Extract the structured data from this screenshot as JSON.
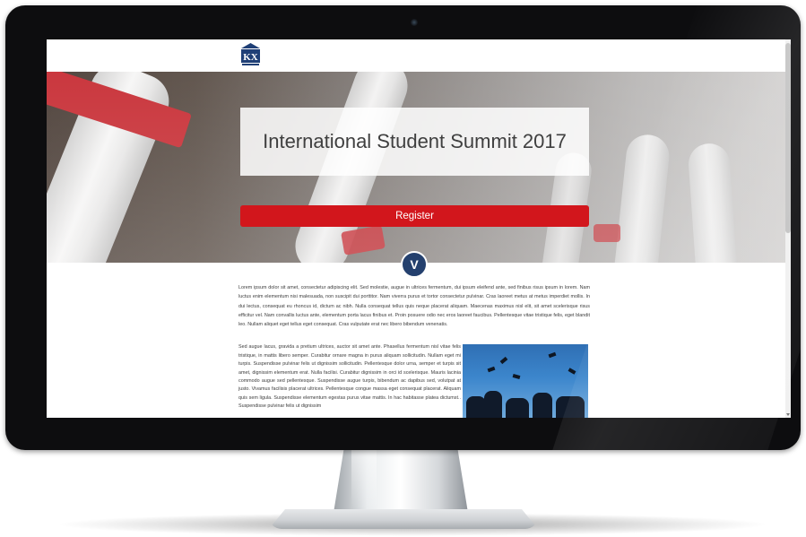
{
  "site": {
    "logo_text": "KX",
    "hero_title": "International Student Summit 2017",
    "register_label": "Register",
    "scroll_down_icon": "chevron-down-icon",
    "scroll_down_glyph": "V"
  },
  "article": {
    "paragraph": "Lorem ipsum dolor sit amet, consectetur adipiscing elit. Sed molestie, augue in ultrices fermentum, dui ipsum eleifend ante, sed finibus risus ipsum in lorem. Nam luctus enim elementum nisi malesuada, non suscipit dui porttitor. Nam viverra purus et tortor consectetur pulvinar. Cras laoreet metus at metus imperdiet mollis. In dui lectus, consequat eu rhoncus id, dictum ac nibh. Nulla consequat tellus quis neque placerat aliquam. Maecenas maximus nisl elit, sit amet scelerisque risus efficitur vel. Nam convallis luctus ante, elementum porta lacus finibus et. Proin posuere odio nec eros laoreet faucibus. Pellentesque vitae tristique felis, eget blandit leo. Nullam aliquet eget tellus eget consequat. Cras vulputate erat nec libero bibendum venenatis.",
    "paragraph_2": "Sed augue lacus, gravida a pretium ultrices, auctor sit amet ante. Phasellus fermentum nisl vitae felis tristique, in mattis libero semper. Curabitur ornare magna in purus aliquam sollicitudin. Nullam eget mi turpis. Suspendisse pulvinar felis ut dignissim sollicitudin. Pellentesque dolor urna, semper et turpis sit amet, dignissim elementum erat. Nulla facilisi. Curabitur dignissim in orci id scelerisque. Mauris lacinia commodo augue sed pellentesque. Suspendisse augue turpis, bibendum ac dapibus sed, volutpat at justo. Vivamus facilisis placerat ultrices. Pellentesque congue massa eget consequat placerat. Aliquam quis sem ligula. Suspendisse elementum egestas purus vitae mattis. In hac habitasse platea dictumst.. Suspendisse pulvinar felis ut dignissim"
  },
  "colors": {
    "accent_red": "#d2161c",
    "badge_navy": "#24406e",
    "bezel": "#0d0d0f"
  }
}
